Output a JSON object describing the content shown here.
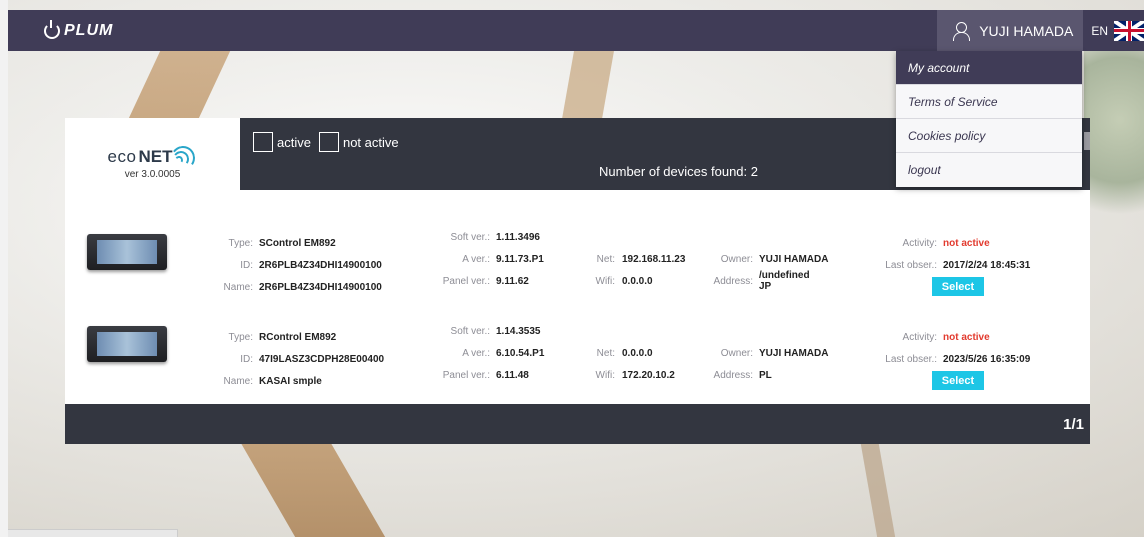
{
  "header": {
    "logo_text": "PLUM",
    "user_name": "YUJI HAMADA",
    "language": "EN"
  },
  "user_menu": {
    "items": [
      {
        "label": "My account",
        "active": true
      },
      {
        "label": "Terms of Service",
        "active": false
      },
      {
        "label": "Cookies policy",
        "active": false
      },
      {
        "label": "logout",
        "active": false
      }
    ]
  },
  "brand": {
    "name_part1": "eco",
    "name_part2": "NET",
    "version": "ver 3.0.0005"
  },
  "filters": {
    "active_label": "active",
    "not_active_label": "not active"
  },
  "summary": {
    "devices_found": "Number of devices found: 2"
  },
  "labels": {
    "type": "Type:",
    "id": "ID:",
    "name": "Name:",
    "soft_ver": "Soft ver.:",
    "a_ver": "A ver.:",
    "panel_ver": "Panel ver.:",
    "net": "Net:",
    "wifi": "Wifi:",
    "owner": "Owner:",
    "address": "Address:",
    "activity": "Activity:",
    "last_obser": "Last obser.:",
    "select": "Select"
  },
  "devices": [
    {
      "type": "SControl EM892",
      "id": "2R6PLB4Z34DHI14900100",
      "name": "2R6PLB4Z34DHI14900100",
      "soft_ver": "1.11.3496",
      "a_ver": "9.11.73.P1",
      "panel_ver": "9.11.62",
      "net": "192.168.11.23",
      "wifi": "0.0.0.0",
      "owner": "YUJI HAMADA",
      "address_line1": "/undefined",
      "address_line2": "JP",
      "activity": "not active",
      "last_obser": "2017/2/24 18:45:31"
    },
    {
      "type": "RControl EM892",
      "id": "47I9LASZ3CDPH28E00400",
      "name": "KASAI smple",
      "soft_ver": "1.14.3535",
      "a_ver": "6.10.54.P1",
      "panel_ver": "6.11.48",
      "net": "0.0.0.0",
      "wifi": "172.20.10.2",
      "owner": "YUJI HAMADA",
      "address_line1": "PL",
      "address_line2": "",
      "activity": "not active",
      "last_obser": "2023/5/26 16:35:09"
    }
  ],
  "pagination": {
    "text": "1/1"
  },
  "colors": {
    "topbar": "#403c57",
    "dark_panel": "#333640",
    "select_button": "#1dc6e6",
    "inactive_text": "#e23a2e"
  }
}
